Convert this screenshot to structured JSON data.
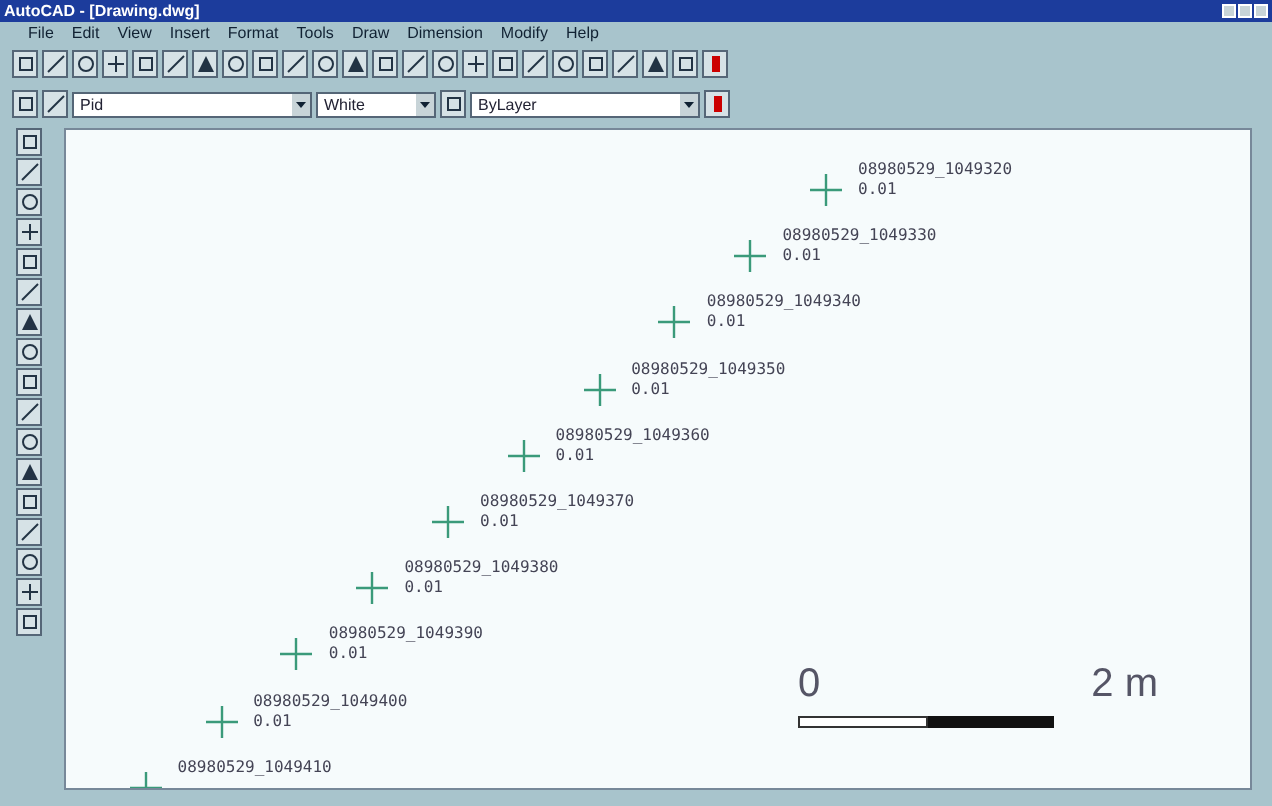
{
  "window": {
    "title": "AutoCAD - [Drawing.dwg]"
  },
  "menu": [
    "File",
    "Edit",
    "View",
    "Insert",
    "Format",
    "Tools",
    "Draw",
    "Dimension",
    "Modify",
    "Help"
  ],
  "properties": {
    "layer": "Pid",
    "color_name": "White",
    "linetype": "ByLayer"
  },
  "points": [
    {
      "name": "08980529_1049320",
      "value": "0.01"
    },
    {
      "name": "08980529_1049330",
      "value": "0.01"
    },
    {
      "name": "08980529_1049340",
      "value": "0.01"
    },
    {
      "name": "08980529_1049350",
      "value": "0.01"
    },
    {
      "name": "08980529_1049360",
      "value": "0.01"
    },
    {
      "name": "08980529_1049370",
      "value": "0.01"
    },
    {
      "name": "08980529_1049380",
      "value": "0.01"
    },
    {
      "name": "08980529_1049390",
      "value": "0.01"
    },
    {
      "name": "08980529_1049400",
      "value": "0.01"
    },
    {
      "name": "08980529_1049410"
    }
  ],
  "scale_bar": {
    "start": "0",
    "end": "2 m"
  }
}
